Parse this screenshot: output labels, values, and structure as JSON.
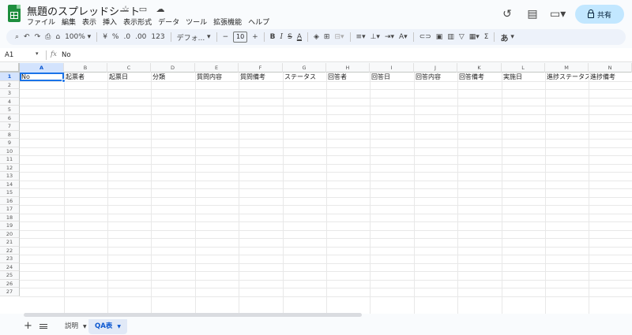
{
  "header": {
    "title": "無題のスプレッドシート",
    "menu": [
      "ファイル",
      "編集",
      "表示",
      "挿入",
      "表示形式",
      "データ",
      "ツール",
      "拡張機能",
      "ヘルプ"
    ],
    "share_label": "共有"
  },
  "toolbar": {
    "zoom": "100%",
    "currency": "¥",
    "percent": "%",
    "dec_decrease": ".0",
    "dec_increase": ".00",
    "number_format": "123",
    "font": "デフォ...",
    "font_size": "10",
    "bold": "B",
    "italic": "I",
    "strike": "S",
    "text_color": "A",
    "input_tools": "あ",
    "sigma": "Σ"
  },
  "formula_bar": {
    "name_box": "A1",
    "fx": "fx",
    "content": "No"
  },
  "columns": [
    "A",
    "B",
    "C",
    "D",
    "E",
    "F",
    "G",
    "H",
    "I",
    "J",
    "K",
    "L",
    "M",
    "N"
  ],
  "header_row": [
    "No",
    "起票者",
    "起票日",
    "分類",
    "質問内容",
    "質問備考",
    "ステータス",
    "回答者",
    "回答日",
    "回答内容",
    "回答備考",
    "実施日",
    "進捗ステータス",
    "進捗備考"
  ],
  "row_numbers": [
    "1",
    "2",
    "3",
    "4",
    "5",
    "6",
    "7",
    "8",
    "9",
    "10",
    "11",
    "12",
    "13",
    "14",
    "15",
    "16",
    "17",
    "18",
    "19",
    "20",
    "21",
    "22",
    "23",
    "24",
    "25",
    "26",
    "27"
  ],
  "sheets": {
    "tabs": [
      {
        "label": "説明",
        "active": false
      },
      {
        "label": "QA表",
        "active": true
      }
    ]
  },
  "colors": {
    "accent": "#1a73e8",
    "share_bg": "#c2e7ff",
    "logo": "#1e8e3e"
  }
}
